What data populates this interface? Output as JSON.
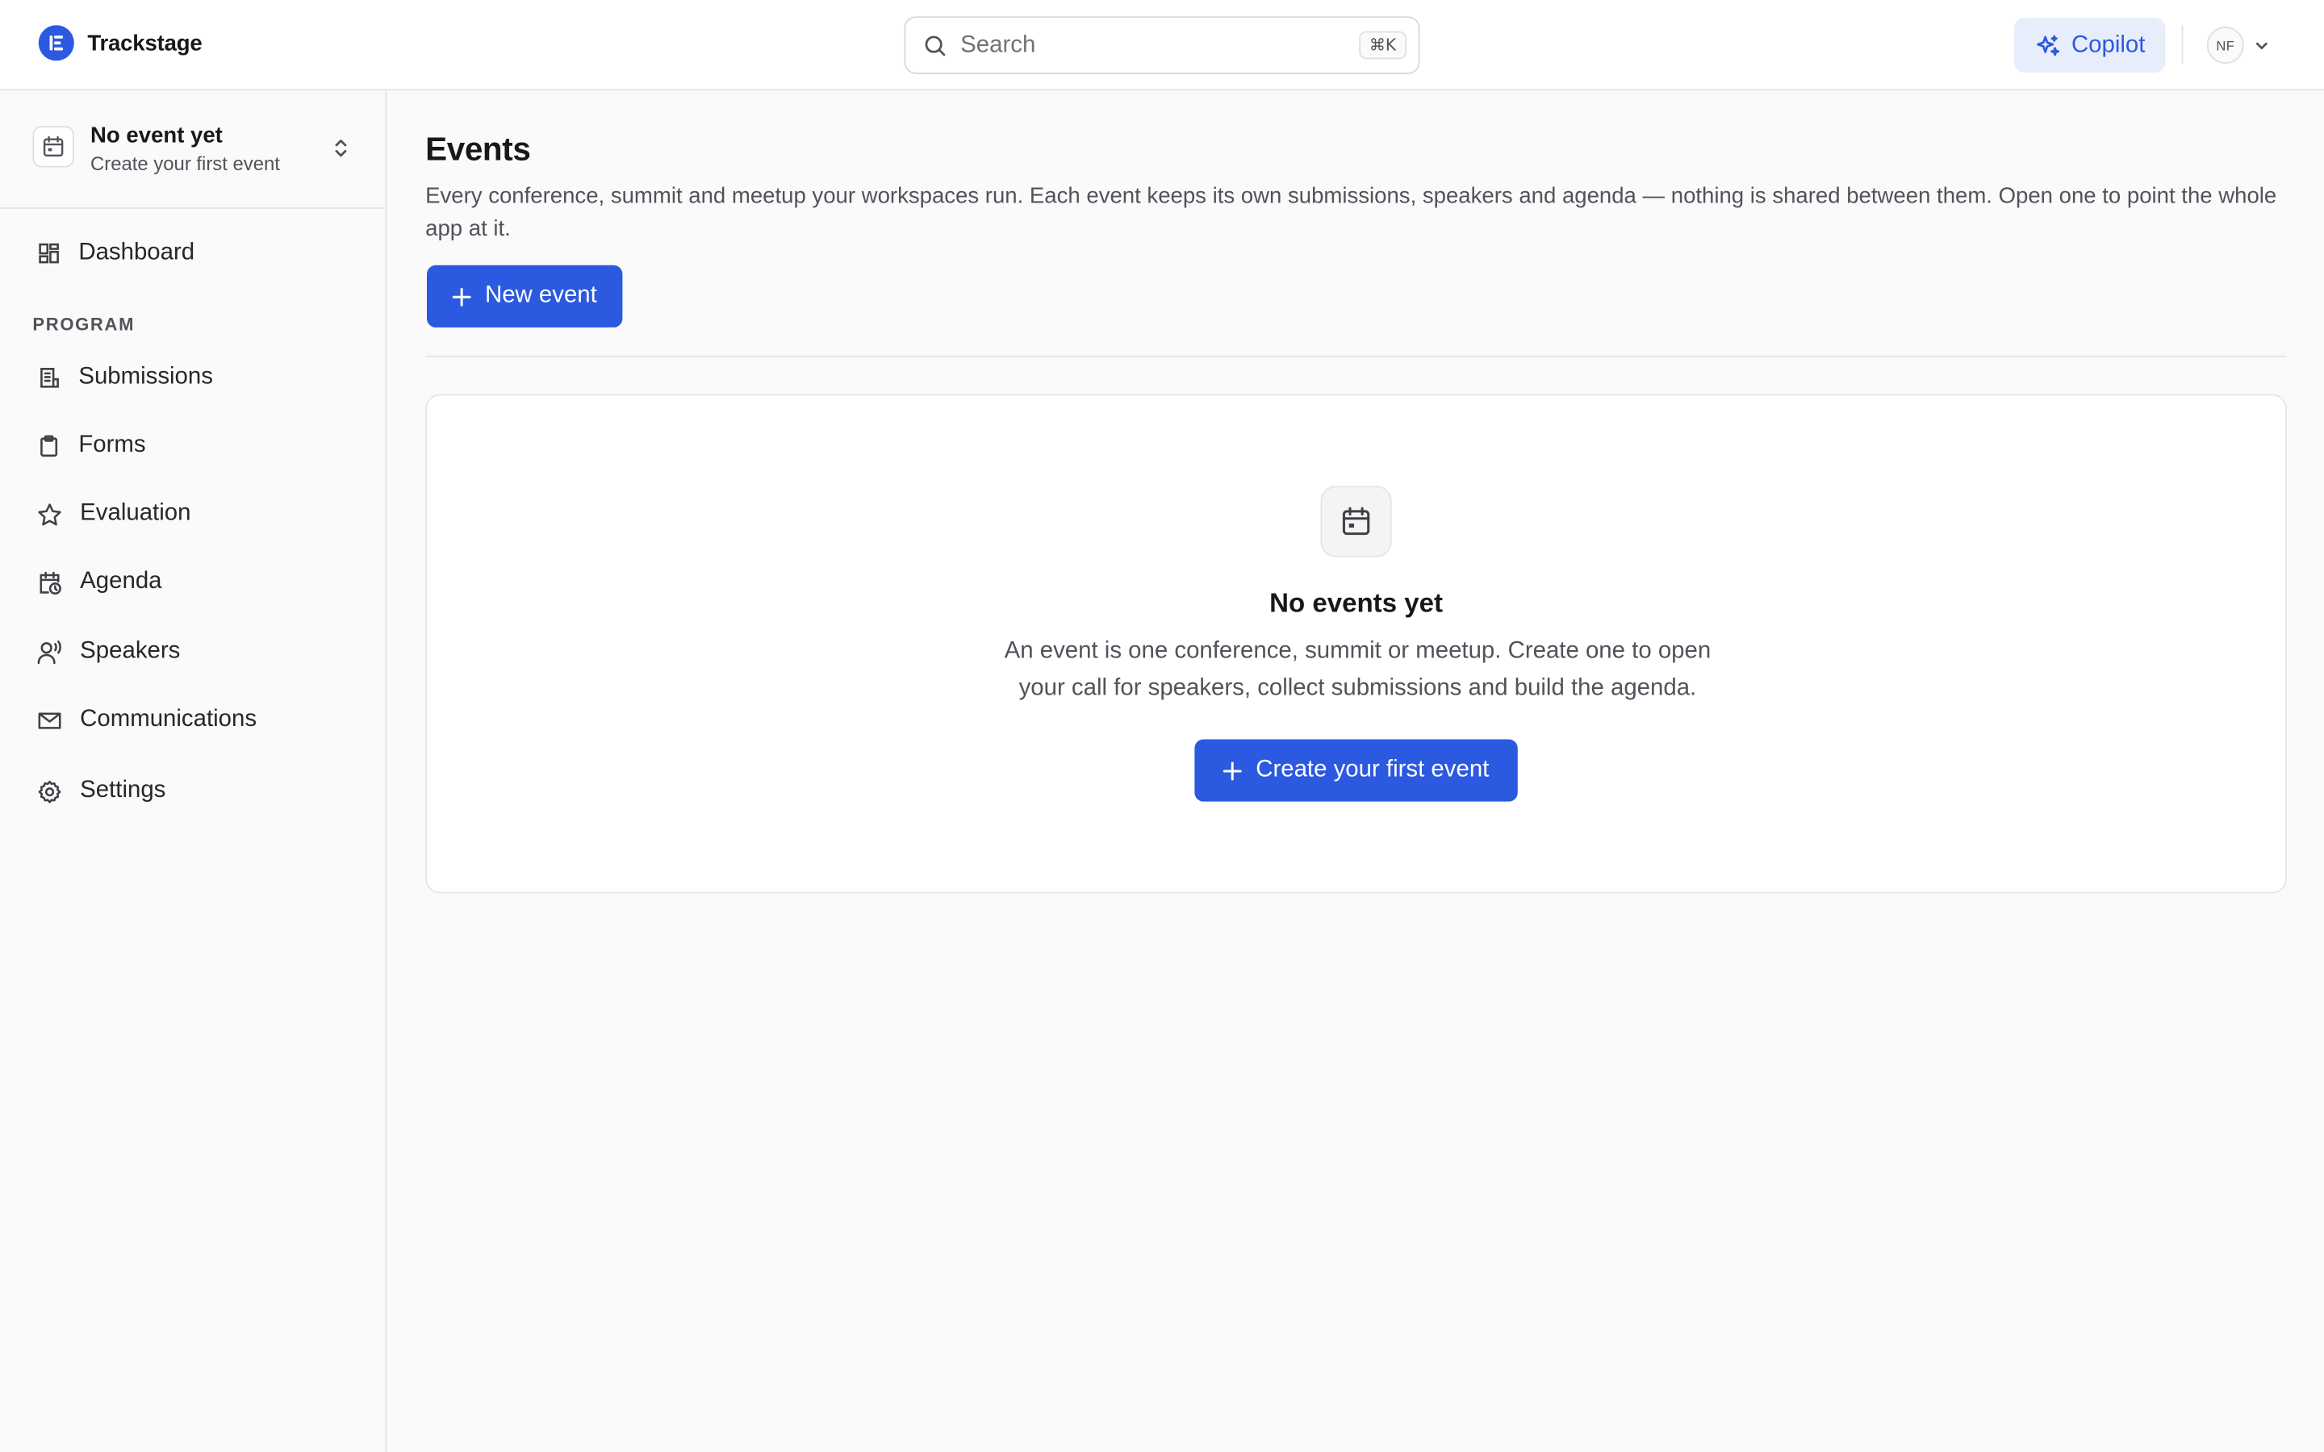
{
  "app": {
    "name": "Trackstage"
  },
  "header": {
    "search_placeholder": "Search",
    "search_shortcut": "⌘K",
    "copilot_label": "Copilot",
    "user_initials": "NF"
  },
  "sidebar": {
    "event_switcher": {
      "title": "No event yet",
      "subtitle": "Create your first event"
    },
    "dashboard": "Dashboard",
    "section_program": "PROGRAM",
    "items": [
      {
        "label": "Submissions",
        "icon": "submissions-icon"
      },
      {
        "label": "Forms",
        "icon": "clipboard-icon"
      },
      {
        "label": "Evaluation",
        "icon": "star-icon"
      },
      {
        "label": "Agenda",
        "icon": "calendar-clock-icon"
      },
      {
        "label": "Speakers",
        "icon": "speaker-icon"
      },
      {
        "label": "Communications",
        "icon": "mail-icon"
      },
      {
        "label": "Settings",
        "icon": "gear-icon"
      }
    ]
  },
  "main": {
    "title": "Events",
    "description": "Every conference, summit and meetup your workspaces run. Each event keeps its own submissions, speakers and agenda — nothing is shared between them. Open one to point the whole app at it.",
    "new_event_label": "New event",
    "empty_state": {
      "title": "No events yet",
      "description": "An event is one conference, summit or meetup. Create one to open your call for speakers, collect submissions and build the agenda.",
      "cta_label": "Create your first event"
    }
  },
  "colors": {
    "accent": "#2b59e0",
    "copilot_bg": "#e8edfb",
    "border": "#e5e5e5"
  }
}
